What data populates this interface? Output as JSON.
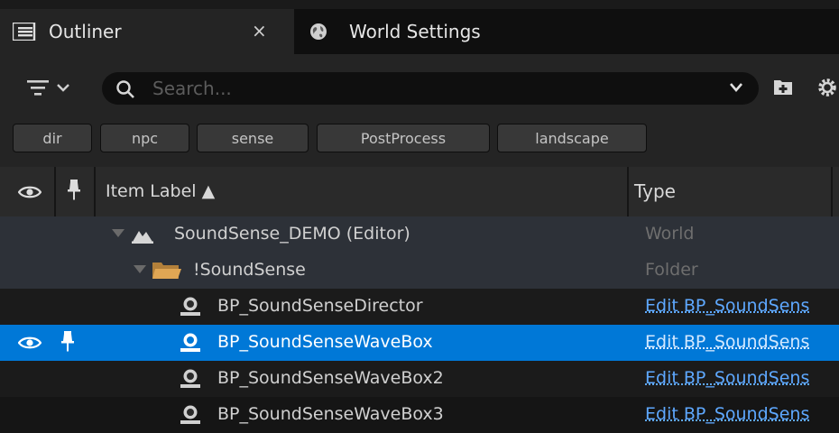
{
  "tabs": [
    {
      "label": "Outliner",
      "icon": "outliner-icon",
      "active": true,
      "close_glyph": "×"
    },
    {
      "label": "World Settings",
      "icon": "globe-icon",
      "active": false
    }
  ],
  "search": {
    "placeholder": "Search..."
  },
  "filter_chips": [
    "dir",
    "npc",
    "sense",
    "PostProcess",
    "landscape"
  ],
  "columns": {
    "visibility_icon": "eye-icon",
    "pin_icon": "pin-icon",
    "label": "Item Label ▲",
    "type": "Type"
  },
  "rows": [
    {
      "name": "SoundSense_DEMO (Editor)",
      "type": "World",
      "icon": "world-icon"
    },
    {
      "name": "!SoundSense",
      "type": "Folder",
      "icon": "folder-icon"
    },
    {
      "name": "BP_SoundSenseDirector",
      "type": "Edit BP_SoundSens",
      "icon": "actor-icon"
    },
    {
      "name": "BP_SoundSenseWaveBox",
      "type": "Edit BP_SoundSens",
      "icon": "actor-icon",
      "selected": true
    },
    {
      "name": "BP_SoundSenseWaveBox2",
      "type": "Edit BP_SoundSens",
      "icon": "actor-icon"
    },
    {
      "name": "BP_SoundSenseWaveBox3",
      "type": "Edit BP_SoundSens",
      "icon": "actor-icon"
    }
  ],
  "colors": {
    "selection": "#0078d7",
    "link": "#5ea8ff",
    "panel": "#242424",
    "folder": "#d9a050"
  }
}
